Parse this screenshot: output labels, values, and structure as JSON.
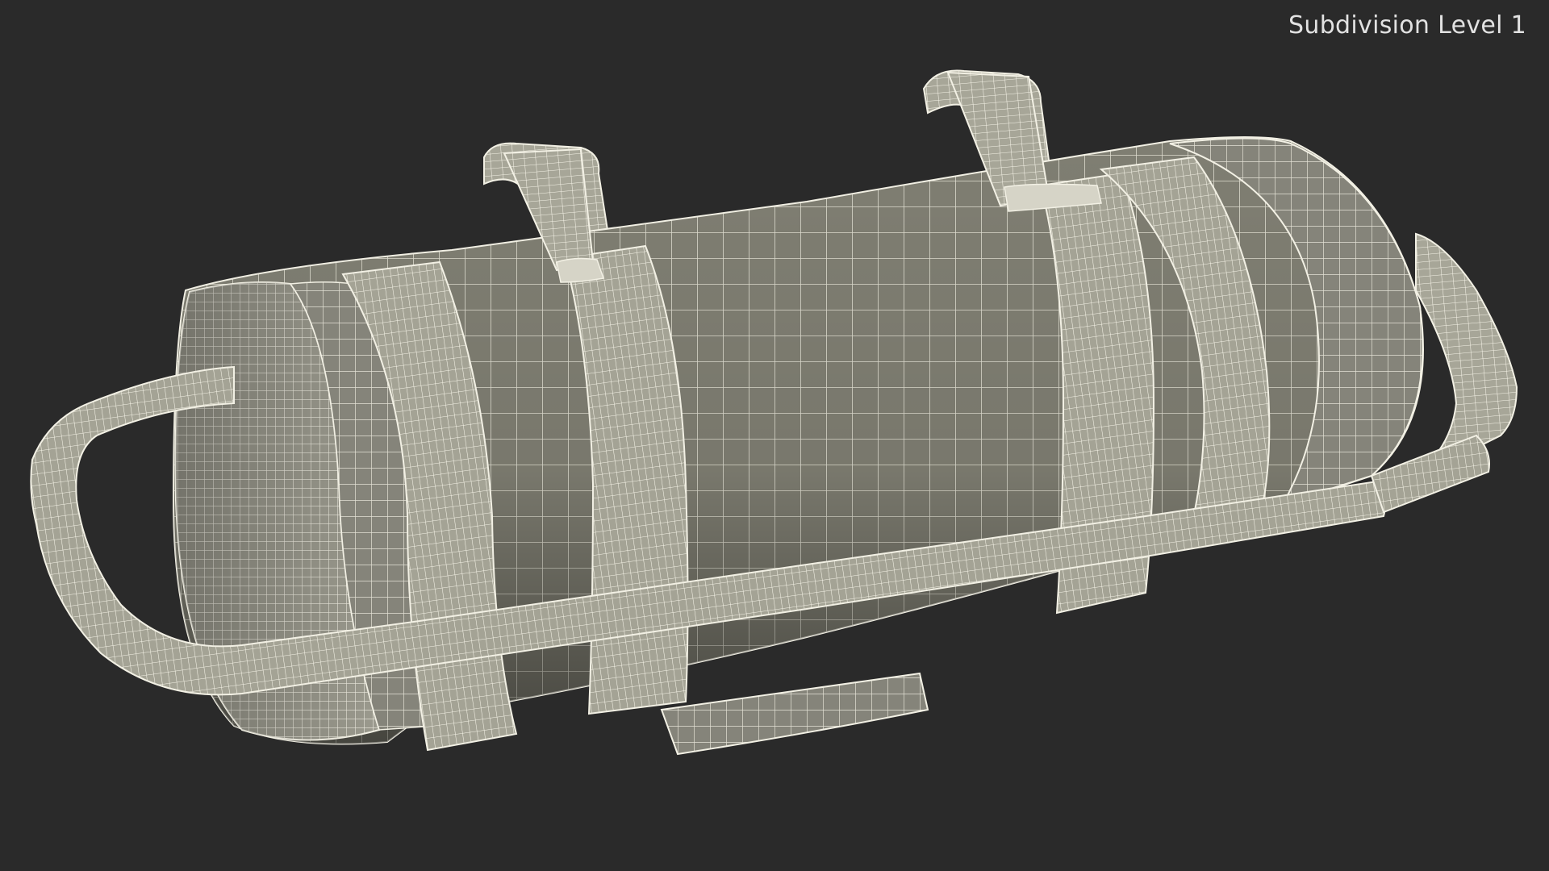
{
  "viewport": {
    "label": "Subdivision Level 1",
    "background": "#2a2a2a",
    "mesh_fill": "#7f7e72",
    "wire_color": "#f1efe2"
  },
  "model": {
    "icon": "sandbag-wireframe-icon"
  }
}
